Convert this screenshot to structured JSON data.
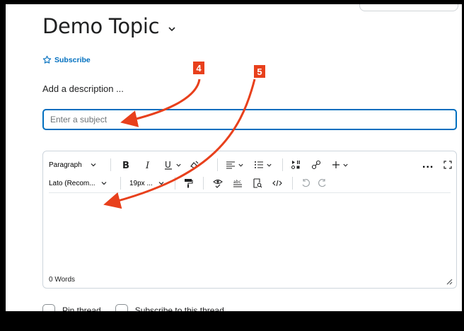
{
  "topic": {
    "title": "Demo Topic"
  },
  "subscribe_label": "Subscribe",
  "description_prompt": "Add a description ...",
  "subject": {
    "placeholder": "Enter a subject",
    "value": ""
  },
  "toolbar": {
    "format_block": "Paragraph",
    "font_family": "Lato (Recom...",
    "font_size": "19px ...",
    "more_label": "..."
  },
  "editor": {
    "word_count": "0 Words"
  },
  "checkboxes": {
    "pin_thread": "Pin thread",
    "subscribe_thread": "Subscribe to this thread"
  },
  "annotations": {
    "step_4": "4",
    "step_5": "5",
    "color": "#e8401c"
  },
  "colors": {
    "accent": "#006fbf",
    "annotation": "#e8401c"
  }
}
